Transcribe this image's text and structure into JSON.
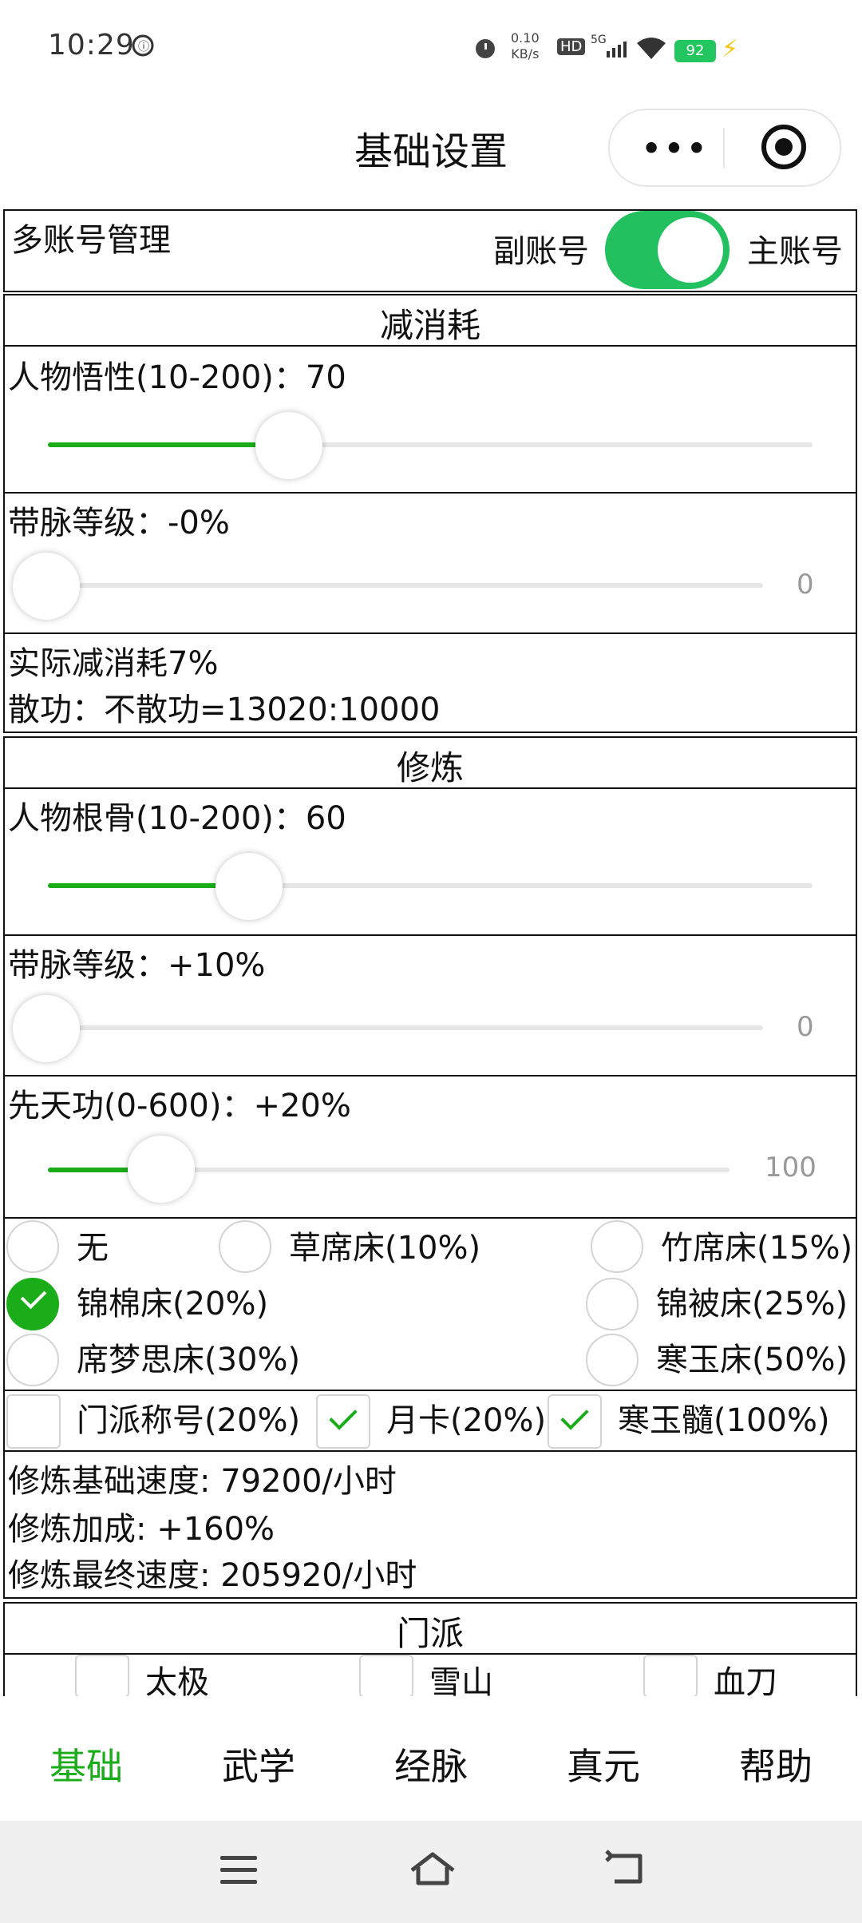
{
  "status_bar": {
    "time": "10:29",
    "net_speed_value": "0.10",
    "net_speed_unit": "KB/s",
    "hd": "HD",
    "signal": "5G",
    "battery": "92"
  },
  "nav": {
    "title": "基础设置",
    "more_icon": "more-dots-icon",
    "close_icon": "target-icon"
  },
  "account": {
    "label": "多账号管理",
    "left_label": "副账号",
    "right_label": "主账号",
    "toggle_on": true
  },
  "reduce": {
    "section_title": "减消耗",
    "wisdom_label": "人物悟性(10-200)：70",
    "wisdom_value": 70,
    "wisdom_min": 10,
    "wisdom_max": 200,
    "vein_label": "带脉等级：-0%",
    "vein_value_text": "0",
    "actual": "实际减消耗7%",
    "ratio": "散功：不散功=13020:10000"
  },
  "cultivate": {
    "section_title": "修炼",
    "bone_label": "人物根骨(10-200)：60",
    "bone_value": 60,
    "vein_label": "带脉等级：+10%",
    "vein_value_text": "0",
    "innate_label": "先天功(0-600)：+20%",
    "innate_value_text": "100",
    "beds": [
      {
        "label": "无",
        "selected": false
      },
      {
        "label": "草席床(10%)",
        "selected": false
      },
      {
        "label": "竹席床(15%)",
        "selected": false
      },
      {
        "label": "锦棉床(20%)",
        "selected": true
      },
      {
        "label": "锦被床(25%)",
        "selected": false
      },
      {
        "label": "席梦思床(30%)",
        "selected": false
      },
      {
        "label": "寒玉床(50%)",
        "selected": false
      }
    ],
    "extras": [
      {
        "label": "门派称号(20%)",
        "checked": false
      },
      {
        "label": "月卡(20%)",
        "checked": true
      },
      {
        "label": "寒玉髓(100%)",
        "checked": true
      }
    ],
    "base_speed": "修炼基础速度: 79200/小时",
    "bonus": "修炼加成: +160%",
    "final_speed": "修炼最终速度: 205920/小时"
  },
  "sect": {
    "section_title": "门派",
    "options": [
      "太极",
      "雪山",
      "血刀"
    ]
  },
  "tabs": [
    "基础",
    "武学",
    "经脉",
    "真元",
    "帮助"
  ],
  "colors": {
    "accent": "#1aad19",
    "toggle": "#22c05e",
    "battery": "#22c55e"
  }
}
